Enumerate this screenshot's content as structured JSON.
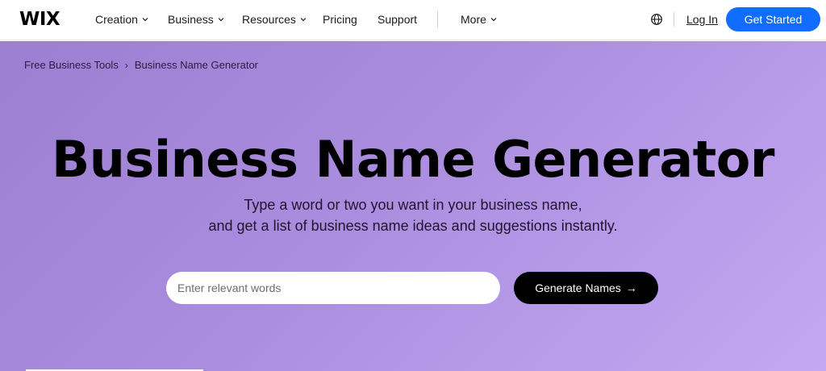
{
  "nav": {
    "logo": "WIX",
    "items": [
      {
        "label": "Creation",
        "dropdown": true
      },
      {
        "label": "Business",
        "dropdown": true
      },
      {
        "label": "Resources",
        "dropdown": true
      },
      {
        "label": "Pricing",
        "dropdown": false
      },
      {
        "label": "Support",
        "dropdown": false
      },
      {
        "label": "More",
        "dropdown": true
      }
    ],
    "login": "Log In",
    "cta": "Get Started"
  },
  "breadcrumb": [
    "Free Business Tools",
    "Business Name Generator"
  ],
  "hero": {
    "title": "Business Name Generator",
    "subtitle_line1": "Type a word or two you want in your business name,",
    "subtitle_line2": "and get a list of business name ideas and suggestions instantly.",
    "input_placeholder": "Enter relevant words",
    "input_value": "",
    "button_label": "Generate Names",
    "button_arrow": "→"
  },
  "colors": {
    "brand_blue": "#116dff",
    "hero_gradient_start": "#9d7fd1",
    "hero_gradient_end": "#c4a8f2",
    "button_black": "#000000"
  },
  "icons": {
    "globe": "globe-icon",
    "chevron": "chevron-down-icon",
    "arrow": "arrow-right-icon"
  }
}
